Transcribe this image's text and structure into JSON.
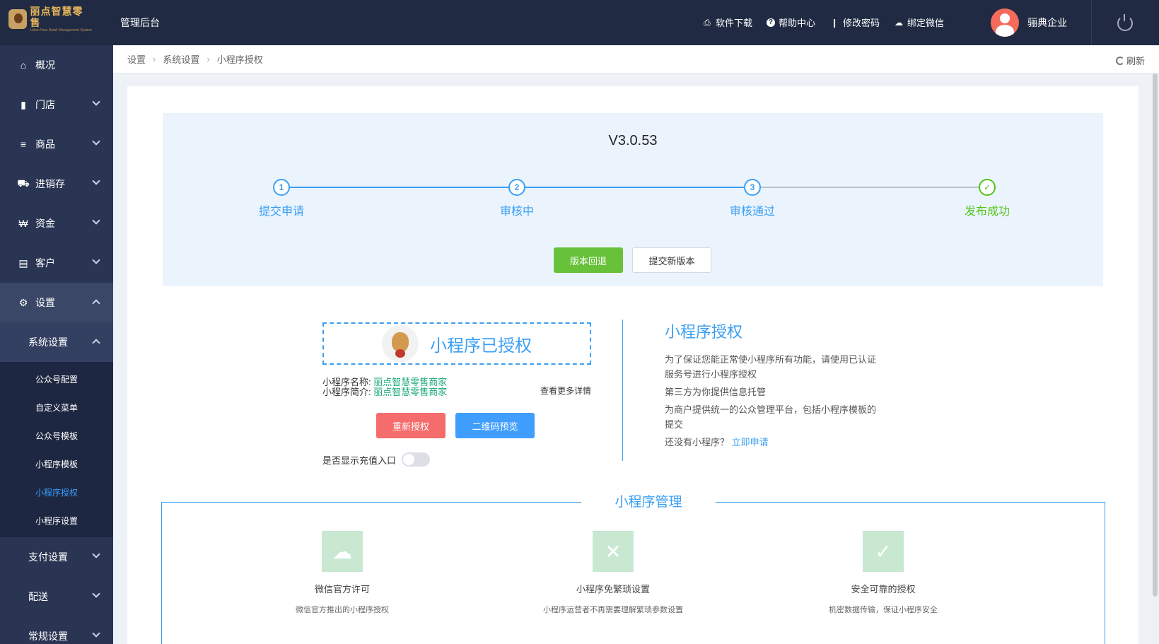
{
  "brand": {
    "name": "丽点智慧零售",
    "tagline": "Lidian New Retail Management System"
  },
  "header": {
    "admin_title": "管理后台",
    "links": {
      "download": "软件下载",
      "help": "帮助中心",
      "change_password": "修改密码",
      "bind_wechat": "绑定微信"
    },
    "user_name": "骊典企业"
  },
  "sidebar": {
    "overview": "概况",
    "store": "门店",
    "goods": "商品",
    "inventory": "进销存",
    "funds": "资金",
    "customers": "客户",
    "settings": "设置",
    "system_settings": "系统设置",
    "sub_items": [
      "公众号配置",
      "自定义菜单",
      "公众号模板",
      "小程序模板",
      "小程序授权",
      "小程序设置"
    ],
    "active_sub_index": 4,
    "payment_settings": "支付设置",
    "delivery": "配送",
    "general_settings": "常规设置"
  },
  "breadcrumb": {
    "items": [
      "设置",
      "系统设置",
      "小程序授权"
    ],
    "refresh": "刷新"
  },
  "version": {
    "title": "V3.0.53",
    "steps": [
      {
        "num": "1",
        "label": "提交申请"
      },
      {
        "num": "2",
        "label": "审核中"
      },
      {
        "num": "3",
        "label": "审核通过"
      },
      {
        "num": "✓",
        "label": "发布成功"
      }
    ],
    "rollback": "版本回退",
    "submit_new": "提交新版本"
  },
  "auth": {
    "status": "小程序已授权",
    "name_label": "小程序名称:",
    "name_value": "丽点智慧零售商家",
    "intro_label": "小程序简介:",
    "intro_value": "丽点智慧零售商家",
    "more": "查看更多详情",
    "reauth": "重新授权",
    "qr_preview": "二维码预览",
    "recharge_toggle": "是否显示充值入口"
  },
  "info": {
    "title": "小程序授权",
    "p1": "为了保证您能正常使小程序所有功能，请使用已认证服务号进行小程序授权",
    "p2": "第三方为你提供信息托管",
    "p3": "为商户提供统一的公众管理平台，包括小程序模板的提交",
    "p4_prefix": "还没有小程序？",
    "p4_link": "立即申请"
  },
  "management": {
    "title": "小程序管理",
    "features": [
      {
        "name": "微信官方许可",
        "desc": "微信官方推出的小程序授权",
        "icon": "wechat-icon"
      },
      {
        "name": "小程序免繁琐设置",
        "desc": "小程序运营者不再需要理解繁琐参数设置",
        "icon": "tools-icon"
      },
      {
        "name": "安全可靠的授权",
        "desc": "机密数据传输，保证小程序安全",
        "icon": "shield-icon"
      }
    ]
  },
  "colors": {
    "primary": "#3b9ff3",
    "success": "#67c23a",
    "danger": "#f56c6c",
    "sidebar": "#2a3553",
    "topbar": "#202b43"
  }
}
